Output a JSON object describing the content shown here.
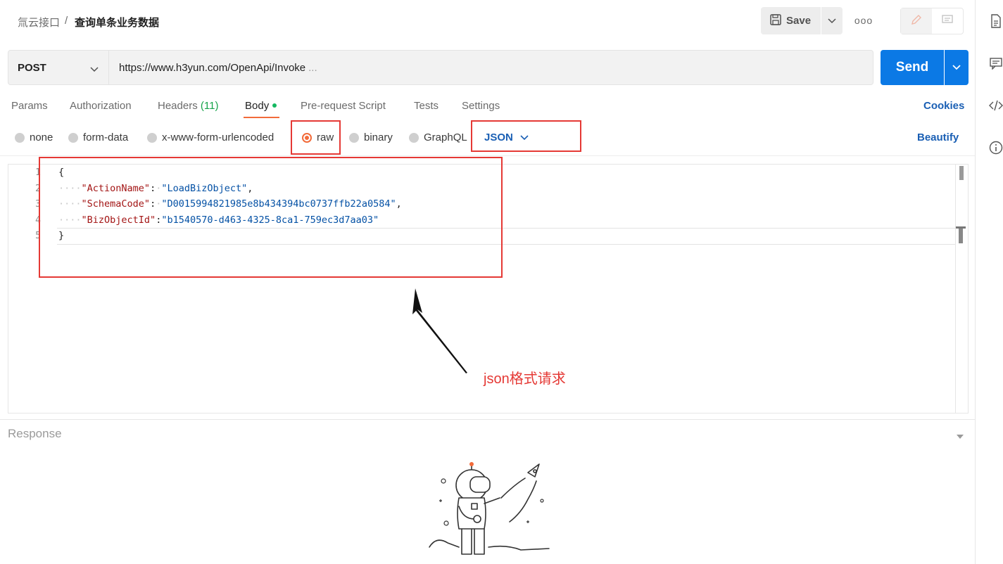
{
  "header": {
    "collection": "氚云接口",
    "separator": "/",
    "request_name": "查询单条业务数据",
    "save_label": "Save",
    "more_label": "ooo"
  },
  "request": {
    "method": "POST",
    "url": "https://www.h3yun.com/OpenApi/Invoke",
    "url_ellipsis": "...",
    "send_label": "Send"
  },
  "tabs": {
    "params": "Params",
    "authorization": "Authorization",
    "headers": "Headers",
    "headers_count": "(11)",
    "body": "Body",
    "prerequest": "Pre-request Script",
    "tests": "Tests",
    "settings": "Settings",
    "active": "Body",
    "cookies": "Cookies"
  },
  "body_types": {
    "none": "none",
    "form_data": "form-data",
    "urlencoded": "x-www-form-urlencoded",
    "raw": "raw",
    "binary": "binary",
    "graphql": "GraphQL",
    "selected": "raw",
    "language": "JSON",
    "beautify": "Beautify"
  },
  "editor": {
    "line_numbers": [
      "1",
      "2",
      "3",
      "4",
      "5"
    ],
    "open_brace": "{",
    "close_brace": "}",
    "fields": [
      {
        "key": "\"ActionName\"",
        "value": "\"LoadBizObject\"",
        "trail": ","
      },
      {
        "key": "\"SchemaCode\"",
        "value": "\"D0015994821985e8b434394bc0737ffb22a0584\"",
        "trail": ","
      },
      {
        "key": "\"BizObjectId\"",
        "value": "\"b1540570-d463-4325-8ca1-759ec3d7aa03\"",
        "trail": ""
      }
    ]
  },
  "annotation": {
    "text": "json格式请求",
    "color": "#e53935"
  },
  "response": {
    "label": "Response"
  },
  "colors": {
    "accent": "#f26b3a",
    "send": "#0b79e5",
    "link": "#1a5fb4",
    "dirty_dot": "#14b861"
  }
}
